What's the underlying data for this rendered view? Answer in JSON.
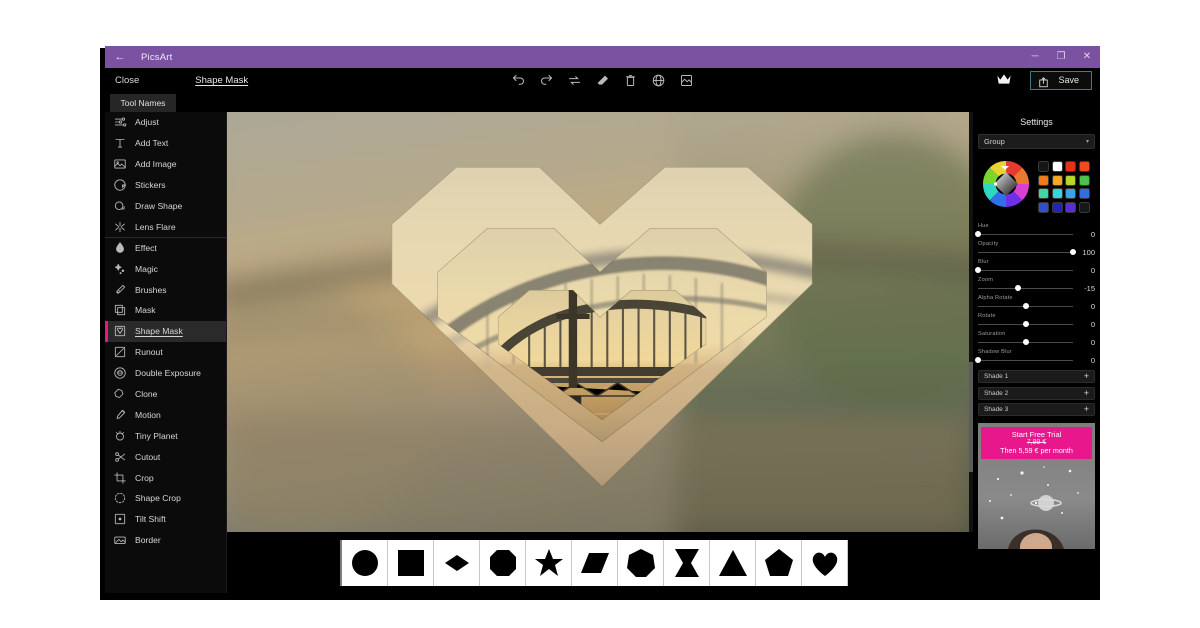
{
  "window": {
    "app_title": "PicsArt",
    "back_icon": "back-arrow-icon",
    "controls": {
      "minimize": "─",
      "maximize": "❐",
      "close": "✕"
    },
    "titlebar_color": "#7a52a1"
  },
  "menu": {
    "close_label": "Close",
    "mode_title": "Shape Mask",
    "tool_names_tab": "Tool Names"
  },
  "toolbar": {
    "icons": [
      {
        "name": "undo-icon",
        "label": "Undo"
      },
      {
        "name": "redo-icon",
        "label": "Redo"
      },
      {
        "name": "reset-icon",
        "label": "Reset"
      },
      {
        "name": "eraser-icon",
        "label": "Eraser"
      },
      {
        "name": "delete-icon",
        "label": "Delete"
      },
      {
        "name": "globe-icon",
        "label": "Globe"
      },
      {
        "name": "fit-frame-icon",
        "label": "Fit Frame"
      }
    ],
    "crown_icon": "crown-icon",
    "save_icon": "share-icon",
    "save_label": "Save",
    "save_border_color": "#3c7f84"
  },
  "tools": {
    "items": [
      {
        "label": "Adjust",
        "icon": "sliders-icon",
        "active": false,
        "group_start": false
      },
      {
        "label": "Add Text",
        "icon": "text-icon",
        "active": false,
        "group_start": false
      },
      {
        "label": "Add Image",
        "icon": "image-icon",
        "active": false,
        "group_start": false
      },
      {
        "label": "Stickers",
        "icon": "sticker-icon",
        "active": false,
        "group_start": false
      },
      {
        "label": "Draw Shape",
        "icon": "draw-shape-icon",
        "active": false,
        "group_start": false
      },
      {
        "label": "Lens Flare",
        "icon": "lens-flare-icon",
        "active": false,
        "group_start": false
      },
      {
        "label": "Effect",
        "icon": "effect-drop-icon",
        "active": false,
        "group_start": true
      },
      {
        "label": "Magic",
        "icon": "magic-sparkle-icon",
        "active": false,
        "group_start": false
      },
      {
        "label": "Brushes",
        "icon": "brush-icon",
        "active": false,
        "group_start": false
      },
      {
        "label": "Mask",
        "icon": "mask-icon",
        "active": false,
        "group_start": false
      },
      {
        "label": "Shape Mask",
        "icon": "shape-mask-icon",
        "active": true,
        "group_start": false
      },
      {
        "label": "Runout",
        "icon": "runout-icon",
        "active": false,
        "group_start": false
      },
      {
        "label": "Double Exposure",
        "icon": "double-exposure-icon",
        "active": false,
        "group_start": false
      },
      {
        "label": "Clone",
        "icon": "clone-icon",
        "active": false,
        "group_start": false
      },
      {
        "label": "Motion",
        "icon": "motion-icon",
        "active": false,
        "group_start": false
      },
      {
        "label": "Tiny Planet",
        "icon": "tiny-planet-icon",
        "active": false,
        "group_start": false
      },
      {
        "label": "Cutout",
        "icon": "scissors-icon",
        "active": false,
        "group_start": false
      },
      {
        "label": "Crop",
        "icon": "crop-icon",
        "active": false,
        "group_start": false
      },
      {
        "label": "Shape Crop",
        "icon": "shape-crop-icon",
        "active": false,
        "group_start": false
      },
      {
        "label": "Tilt Shift",
        "icon": "tilt-shift-icon",
        "active": false,
        "group_start": false
      },
      {
        "label": "Border",
        "icon": "border-icon",
        "active": false,
        "group_start": false
      }
    ],
    "active_accent": "#e8197d"
  },
  "shape_picker": {
    "shapes": [
      {
        "name": "circle-shape",
        "label": "Circle"
      },
      {
        "name": "square-shape",
        "label": "Square"
      },
      {
        "name": "diamond-shape",
        "label": "Diamond"
      },
      {
        "name": "octagon-shape",
        "label": "Octagon"
      },
      {
        "name": "star-shape",
        "label": "Star"
      },
      {
        "name": "parallelogram-shape",
        "label": "Parallelogram"
      },
      {
        "name": "heptagon-shape",
        "label": "Heptagon"
      },
      {
        "name": "hourglass-shape",
        "label": "Hourglass"
      },
      {
        "name": "triangle-shape",
        "label": "Triangle"
      },
      {
        "name": "pentagon-shape",
        "label": "Pentagon"
      },
      {
        "name": "heart-shape",
        "label": "Heart"
      }
    ]
  },
  "settings": {
    "title": "Settings",
    "group_label": "Group",
    "group_caret": "▾",
    "color_wheel": "color-wheel-picker",
    "swatches": [
      "#161616",
      "#ffffff",
      "#e8301b",
      "#f04a1e",
      "#ef7a18",
      "#f5a623",
      "#b8d62a",
      "#4cc14c",
      "#3fd6a0",
      "#35d6d6",
      "#3ba3e8",
      "#2f6fe0",
      "#2f4fd0",
      "#2323b8",
      "#5a2fd0",
      "#171717"
    ],
    "sliders": [
      {
        "name": "Hue",
        "value": 0,
        "pos": 0
      },
      {
        "name": "Opacity",
        "value": 100,
        "pos": 100
      },
      {
        "name": "Blur",
        "value": 0,
        "pos": 0
      },
      {
        "name": "Zoom",
        "value": -15,
        "pos": 42
      },
      {
        "name": "Alpha Rotate",
        "value": 0,
        "pos": 50
      },
      {
        "name": "Rotate",
        "value": 0,
        "pos": 50
      },
      {
        "name": "Saturation",
        "value": 0,
        "pos": 50
      },
      {
        "name": "Shadow Blur",
        "value": 0,
        "pos": 0
      }
    ],
    "shades": [
      {
        "label": "Shade 1",
        "add": "+"
      },
      {
        "label": "Shade 2",
        "add": "+"
      },
      {
        "label": "Shade 3",
        "add": "+"
      }
    ]
  },
  "promo": {
    "headline": "Start Free Trial",
    "old_price": "7,99 €",
    "then_price": "Then 5,59 € per month",
    "accent": "#e8178c"
  },
  "canvas": {
    "description": "Blurred sunset bridge photo with nested heart shape masks revealing a sharp bridge in the center"
  }
}
